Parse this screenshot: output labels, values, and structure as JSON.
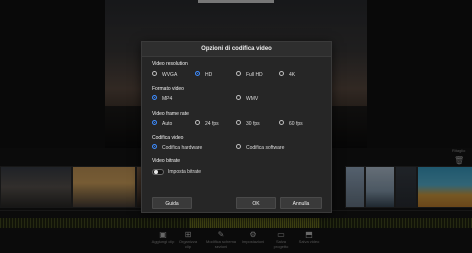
{
  "dialog": {
    "title": "Opzioni di codifica video",
    "sections": {
      "resolution": {
        "label": "Video resolution",
        "options": [
          "WVGA",
          "HD",
          "Full HD",
          "4K"
        ],
        "selected": "HD"
      },
      "format": {
        "label": "Formato video",
        "options": [
          "MP4",
          "WMV"
        ],
        "selected": "MP4"
      },
      "framerate": {
        "label": "Video frame rate",
        "options": [
          "Auto",
          "24 fps",
          "30 fps",
          "60 fps"
        ],
        "selected": "Auto"
      },
      "codec": {
        "label": "Codifica video",
        "options": [
          "Codifica hardware",
          "Codifica software"
        ],
        "selected": "Codifica hardware"
      },
      "bitrate": {
        "label": "Video bitrate",
        "toggle_label": "Imposta bitrate",
        "toggle_on": false
      }
    },
    "buttons": {
      "help": "Guida",
      "ok": "OK",
      "cancel": "Annulla"
    }
  },
  "background": {
    "right_label": "Ritaglio",
    "tools": [
      {
        "icon": "image-icon",
        "label": "Aggiungi clip"
      },
      {
        "icon": "grid-icon",
        "label": "Organizza clip"
      },
      {
        "icon": "edit-icon",
        "label": "Modifica schema sezioni"
      },
      {
        "icon": "gear-icon",
        "label": "Impostazioni"
      },
      {
        "icon": "save-icon",
        "label": "Salva progetto"
      },
      {
        "icon": "export-icon",
        "label": "Salva video"
      }
    ]
  },
  "colors": {
    "accent": "#3d8bfd",
    "dialog_bg": "#262626",
    "app_bg": "#121212"
  }
}
